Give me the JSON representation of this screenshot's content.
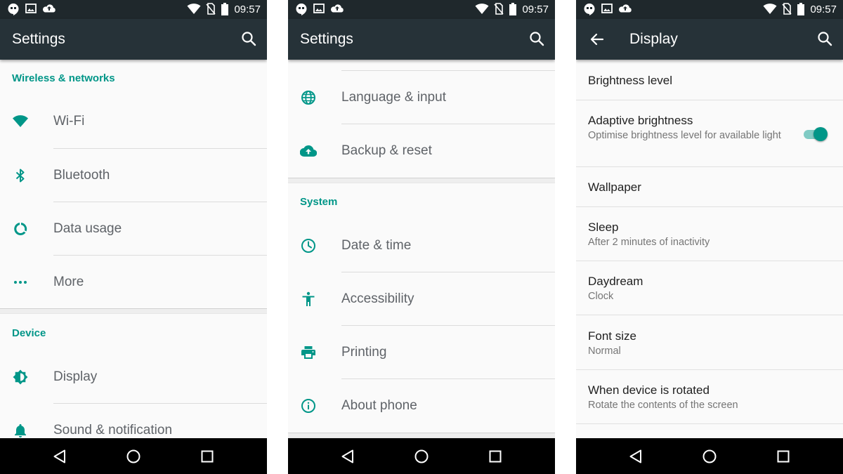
{
  "status": {
    "time": "09:57"
  },
  "colors": {
    "accent": "#009688",
    "appbar": "#263238",
    "statusbar": "#1f282c"
  },
  "screen1": {
    "title": "Settings",
    "sections": [
      {
        "header": "Wireless & networks",
        "items": [
          {
            "label": "Wi-Fi",
            "icon": "wifi-icon"
          },
          {
            "label": "Bluetooth",
            "icon": "bluetooth-icon"
          },
          {
            "label": "Data usage",
            "icon": "data-usage-icon"
          },
          {
            "label": "More",
            "icon": "more-icon"
          }
        ]
      },
      {
        "header": "Device",
        "items": [
          {
            "label": "Display",
            "icon": "brightness-icon"
          },
          {
            "label": "Sound & notification",
            "icon": "bell-icon"
          }
        ]
      }
    ]
  },
  "screen2": {
    "title": "Settings",
    "items_top": [
      {
        "label": "Language & input",
        "icon": "globe-icon"
      },
      {
        "label": "Backup & reset",
        "icon": "cloud-upload-icon"
      }
    ],
    "system_header": "System",
    "items_system": [
      {
        "label": "Date & time",
        "icon": "clock-icon"
      },
      {
        "label": "Accessibility",
        "icon": "accessibility-icon"
      },
      {
        "label": "Printing",
        "icon": "printer-icon"
      },
      {
        "label": "About phone",
        "icon": "info-icon"
      }
    ]
  },
  "screen3": {
    "title": "Display",
    "rows": [
      {
        "title": "Brightness level",
        "summary": ""
      },
      {
        "title": "Adaptive brightness",
        "summary": "Optimise brightness level for available light",
        "toggle_on": true
      },
      {
        "title": "Wallpaper",
        "summary": ""
      },
      {
        "title": "Sleep",
        "summary": "After 2 minutes of inactivity"
      },
      {
        "title": "Daydream",
        "summary": "Clock"
      },
      {
        "title": "Font size",
        "summary": "Normal"
      },
      {
        "title": "When device is rotated",
        "summary": "Rotate the contents of the screen"
      }
    ]
  }
}
